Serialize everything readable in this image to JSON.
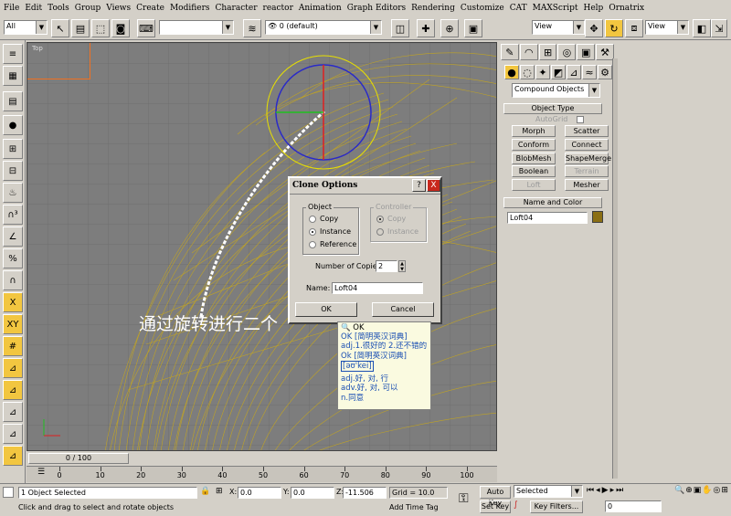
{
  "menu": [
    "File",
    "Edit",
    "Tools",
    "Group",
    "Views",
    "Create",
    "Modifiers",
    "Character",
    "reactor",
    "Animation",
    "Graph Editors",
    "Rendering",
    "Customize",
    "CAT",
    "MAXScript",
    "Help",
    "Ornatrix"
  ],
  "toolbar": {
    "selection_filter": "All",
    "named_selection": "",
    "layer": "0 (default)",
    "ref_coord_1": "View",
    "ref_coord_2": "View"
  },
  "viewport": {
    "label": "Top",
    "caption": "通过旋转进行二个"
  },
  "command_panel": {
    "category": "Compound Objects",
    "object_type_header": "Object Type",
    "autogrid_label": "AutoGrid",
    "buttons": [
      "Morph",
      "Scatter",
      "Conform",
      "Connect",
      "BlobMesh",
      "ShapeMerge",
      "Boolean",
      "Terrain",
      "Loft",
      "Mesher"
    ],
    "name_color_header": "Name and Color",
    "object_name": "Loft04",
    "object_color": "#8b6f14"
  },
  "dialog": {
    "title": "Clone Options",
    "help": "?",
    "close": "X",
    "object_group": "Object",
    "object_options": [
      "Copy",
      "Instance",
      "Reference"
    ],
    "object_selected": 1,
    "controller_group": "Controller",
    "controller_options": [
      "Copy",
      "Instance"
    ],
    "copies_label": "Number of Copies:",
    "copies_value": "2",
    "name_label": "Name:",
    "name_value": "Loft04",
    "ok": "OK",
    "cancel": "Cancel"
  },
  "tooltip": {
    "header": "OK",
    "lines": [
      "OK [简明英汉词典]",
      "adj.1.很好的 2.还不错的",
      "Ok [简明英汉词典]",
      "[əʊ'kei]",
      "adj.好, 对, 行",
      "adv.好, 对, 可以",
      "n.同意"
    ]
  },
  "timeline": {
    "frame_counter": "0 / 100",
    "ticks": [
      "0",
      "10",
      "20",
      "30",
      "40",
      "50",
      "60",
      "70",
      "80",
      "90",
      "100"
    ]
  },
  "status": {
    "selected": "1 Object Selected",
    "prompt": "Click and drag to select and rotate objects",
    "x_label": "X:",
    "x_value": "0.0",
    "y_label": "Y:",
    "y_value": "0.0",
    "z_label": "Z:",
    "z_value": "-11.506",
    "grid": "Grid = 10.0",
    "add_time_tag": "Add Time Tag",
    "auto_key": "Auto Key",
    "set_key": "Set Key",
    "key_mode": "Selected",
    "key_filters": "Key Filters...",
    "current_frame": "0"
  },
  "colors": {
    "panel": "#d4d0c8",
    "viewport_bg": "#7d7d7d",
    "mesh": "#c8a81a",
    "active": "#f2c640"
  }
}
